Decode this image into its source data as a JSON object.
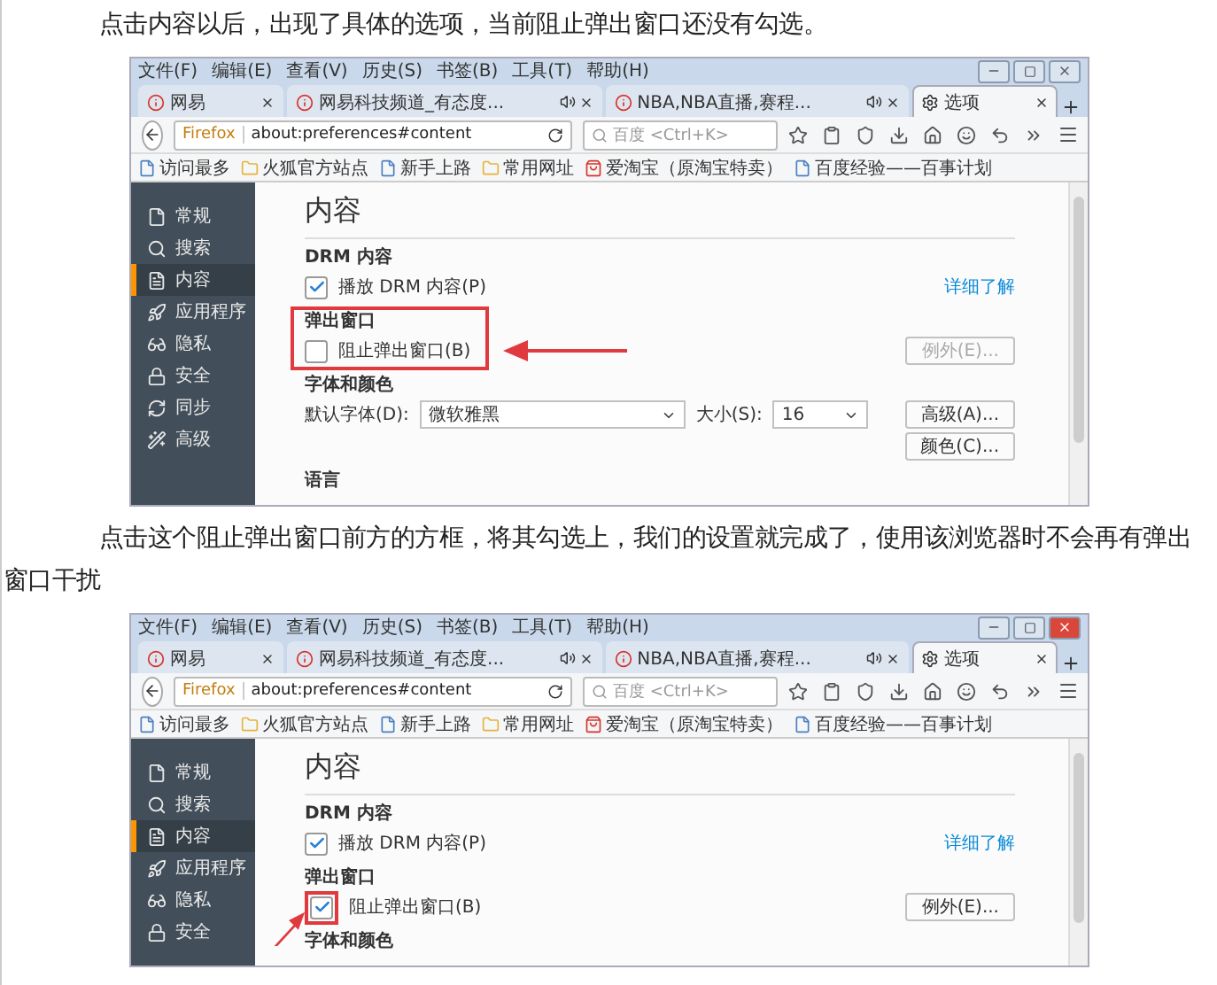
{
  "blocks": [
    {
      "kind": "text",
      "text": "点击内容以后，出现了具体的选项，当前阻止弹出窗口还没有勾选。"
    },
    {
      "kind": "screenshot",
      "window_active": false,
      "menu": [
        "文件(F)",
        "编辑(E)",
        "查看(V)",
        "历史(S)",
        "书签(B)",
        "工具(T)",
        "帮助(H)"
      ],
      "tabs": [
        {
          "label": "网易",
          "kind": "site",
          "audio": false,
          "selected": false
        },
        {
          "label": "网易科技频道_有态度...",
          "kind": "site",
          "audio": true,
          "selected": false
        },
        {
          "label": "NBA,NBA直播,赛程...",
          "kind": "site",
          "audio": true,
          "selected": false
        },
        {
          "label": "选项",
          "kind": "settings",
          "audio": false,
          "selected": true
        }
      ],
      "url_prefix": "Firefox",
      "url": "about:preferences#content",
      "search_placeholder": "百度 <Ctrl+K>",
      "bookmarks": [
        {
          "label": "访问最多",
          "kind": "page"
        },
        {
          "label": "火狐官方站点",
          "kind": "folder"
        },
        {
          "label": "新手上路",
          "kind": "page"
        },
        {
          "label": "常用网址",
          "kind": "folder"
        },
        {
          "label": "爱淘宝（原淘宝特卖）",
          "kind": "shop"
        },
        {
          "label": "百度经验——百事计划",
          "kind": "page"
        }
      ],
      "sidebar": [
        {
          "label": "常规",
          "kind": "general",
          "selected": false
        },
        {
          "label": "搜索",
          "kind": "search",
          "selected": false
        },
        {
          "label": "内容",
          "kind": "content",
          "selected": true
        },
        {
          "label": "应用程序",
          "kind": "apps",
          "selected": false
        },
        {
          "label": "隐私",
          "kind": "privacy",
          "selected": false
        },
        {
          "label": "安全",
          "kind": "security",
          "selected": false
        },
        {
          "label": "同步",
          "kind": "sync",
          "selected": false
        },
        {
          "label": "高级",
          "kind": "advanced",
          "selected": false
        }
      ],
      "heading": "内容",
      "sections": [
        {
          "title": "DRM 内容",
          "kind": "plain",
          "rows": [
            {
              "kind": "checkbox",
              "label": "播放 DRM 内容(P)",
              "checked": true,
              "link": "详细了解"
            }
          ]
        },
        {
          "title": "弹出窗口",
          "kind": "section-highlight",
          "rows": [
            {
              "kind": "checkbox",
              "label": "阻止弹出窗口(B)",
              "checked": false,
              "button": "例外(E)...",
              "disabled": true
            }
          ]
        },
        {
          "title": "字体和颜色",
          "kind": "plain",
          "rows": [
            {
              "kind": "font",
              "font_label": "默认字体(D):",
              "font_value": "微软雅黑",
              "size_label": "大小(S):",
              "size_value": "16",
              "button": "高级(A)..."
            },
            {
              "kind": "button",
              "button": "颜色(C)..."
            }
          ]
        },
        {
          "title": "语言",
          "kind": "plain"
        }
      ]
    },
    {
      "kind": "text",
      "text": "点击这个阻止弹出窗口前方的方框，将其勾选上，我们的设置就完成了，使用该浏览器时不会再有弹出窗口干扰"
    },
    {
      "kind": "screenshot",
      "window_active": true,
      "menu": [
        "文件(F)",
        "编辑(E)",
        "查看(V)",
        "历史(S)",
        "书签(B)",
        "工具(T)",
        "帮助(H)"
      ],
      "tabs": [
        {
          "label": "网易",
          "kind": "site",
          "audio": false,
          "selected": false
        },
        {
          "label": "网易科技频道_有态度...",
          "kind": "site",
          "audio": true,
          "selected": false
        },
        {
          "label": "NBA,NBA直播,赛程...",
          "kind": "site",
          "audio": true,
          "selected": false
        },
        {
          "label": "选项",
          "kind": "settings",
          "audio": false,
          "selected": true
        }
      ],
      "url_prefix": "Firefox",
      "url": "about:preferences#content",
      "search_placeholder": "百度 <Ctrl+K>",
      "bookmarks": [
        {
          "label": "访问最多",
          "kind": "page"
        },
        {
          "label": "火狐官方站点",
          "kind": "folder"
        },
        {
          "label": "新手上路",
          "kind": "page"
        },
        {
          "label": "常用网址",
          "kind": "folder"
        },
        {
          "label": "爱淘宝（原淘宝特卖）",
          "kind": "shop"
        },
        {
          "label": "百度经验——百事计划",
          "kind": "page"
        }
      ],
      "sidebar": [
        {
          "label": "常规",
          "kind": "general",
          "selected": false
        },
        {
          "label": "搜索",
          "kind": "search",
          "selected": false
        },
        {
          "label": "内容",
          "kind": "content",
          "selected": true
        },
        {
          "label": "应用程序",
          "kind": "apps",
          "selected": false
        },
        {
          "label": "隐私",
          "kind": "privacy",
          "selected": false
        },
        {
          "label": "安全",
          "kind": "security",
          "selected": false
        }
      ],
      "heading": "内容",
      "sections": [
        {
          "title": "DRM 内容",
          "kind": "plain",
          "rows": [
            {
              "kind": "checkbox",
              "label": "播放 DRM 内容(P)",
              "checked": true,
              "link": "详细了解"
            }
          ]
        },
        {
          "title": "弹出窗口",
          "kind": "checkbox-highlight",
          "rows": [
            {
              "kind": "checkbox",
              "label": "阻止弹出窗口(B)",
              "checked": true,
              "button": "例外(E)...",
              "disabled": false
            }
          ]
        },
        {
          "title": "字体和颜色",
          "kind": "plain"
        }
      ]
    }
  ]
}
